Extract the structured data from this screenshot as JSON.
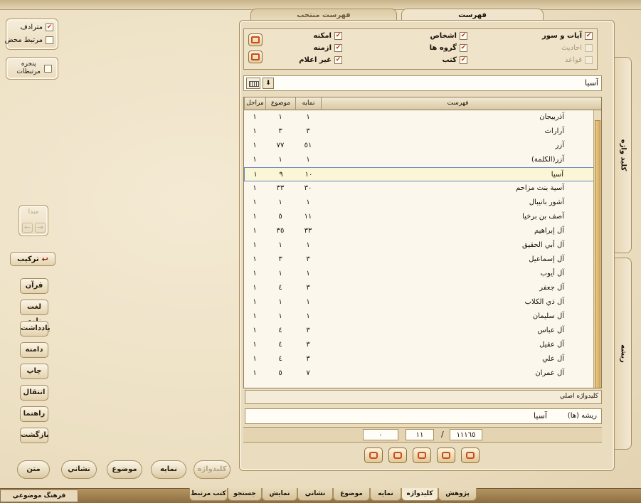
{
  "tabs_top": {
    "index": "فهرست",
    "selected_index": "فهرست منتخب"
  },
  "filters": {
    "col1": [
      {
        "label": "آيات و سور",
        "checked": true,
        "disabled": false
      },
      {
        "label": "احاديث",
        "checked": false,
        "disabled": true
      },
      {
        "label": "قواعد",
        "checked": false,
        "disabled": true
      }
    ],
    "col2": [
      {
        "label": "اشخاص",
        "checked": true,
        "disabled": false
      },
      {
        "label": "گروه ها",
        "checked": true,
        "disabled": false
      },
      {
        "label": "كتب",
        "checked": true,
        "disabled": false
      }
    ],
    "col3": [
      {
        "label": "امكنه",
        "checked": true,
        "disabled": false
      },
      {
        "label": "ازمنه",
        "checked": true,
        "disabled": false
      },
      {
        "label": "غير اعلام",
        "checked": true,
        "disabled": false
      }
    ]
  },
  "left_options": {
    "synonym": "مترادف",
    "pure_related": "مرتبط محض",
    "related_window_1": "پنجره",
    "related_window_2": "مرتبطات"
  },
  "search": {
    "value": "آسيا"
  },
  "table": {
    "headers": {
      "index": "فهرست",
      "occurrence": "نمايه",
      "topic": "موضوع",
      "level": "مراحل"
    },
    "rows": [
      {
        "name": "آذربيجان",
        "occurrence": "١",
        "topic": "١",
        "level": "١"
      },
      {
        "name": "آرارات",
        "occurrence": "٣",
        "topic": "٣",
        "level": "١"
      },
      {
        "name": "آزر",
        "occurrence": "٥١",
        "topic": "٧٧",
        "level": "١"
      },
      {
        "name": "آزر(الكلمة)",
        "occurrence": "١",
        "topic": "١",
        "level": "١"
      },
      {
        "name": "آسيا",
        "occurrence": "١٠",
        "topic": "٩",
        "level": "١"
      },
      {
        "name": "آسية بنت مزاحم",
        "occurrence": "٣٠",
        "topic": "٣٣",
        "level": "١"
      },
      {
        "name": "آشور بانيبال",
        "occurrence": "١",
        "topic": "١",
        "level": "١"
      },
      {
        "name": "آصف بن برخيا",
        "occurrence": "١١",
        "topic": "٥",
        "level": "١"
      },
      {
        "name": "آل إبراهيم",
        "occurrence": "٣٣",
        "topic": "٣٥",
        "level": "١"
      },
      {
        "name": "آل أبي الحقيق",
        "occurrence": "١",
        "topic": "١",
        "level": "١"
      },
      {
        "name": "آل إسماعيل",
        "occurrence": "٣",
        "topic": "٣",
        "level": "١"
      },
      {
        "name": "آل أيوب",
        "occurrence": "١",
        "topic": "١",
        "level": "١"
      },
      {
        "name": "آل جعفر",
        "occurrence": "٣",
        "topic": "٤",
        "level": "١"
      },
      {
        "name": "آل ذي الكلاب",
        "occurrence": "١",
        "topic": "١",
        "level": "١"
      },
      {
        "name": "آل سليمان",
        "occurrence": "١",
        "topic": "١",
        "level": "١"
      },
      {
        "name": "آل عباس",
        "occurrence": "٣",
        "topic": "٤",
        "level": "١"
      },
      {
        "name": "آل عقيل",
        "occurrence": "٣",
        "topic": "٤",
        "level": "١"
      },
      {
        "name": "آل علي",
        "occurrence": "٣",
        "topic": "٤",
        "level": "١"
      },
      {
        "name": "آل عمران",
        "occurrence": "٧",
        "topic": "٥",
        "level": "١"
      }
    ],
    "selected_index": 4
  },
  "root_keyword_label": "كليدواژه اصلي",
  "roots_label": "ريشه (ها)",
  "roots_value": "آسيا",
  "counter": {
    "total": "١١١٦٥",
    "separator": "/",
    "current": "١١",
    "zero": "٠"
  },
  "side_tabs": {
    "keyword": "كليد واژه",
    "root": "ريشه"
  },
  "left_nav": {
    "source": "مبدا",
    "compose": "تركيب",
    "quran": "قرآن",
    "dictionary": "لغت نامه",
    "notes": "يادداشت",
    "scope": "دامنه",
    "print": "چاپ",
    "transfer": "انتقال",
    "guide": "راهنما",
    "back": "بازگشت"
  },
  "bottom_pills": [
    "كليدواژه",
    "نمايه",
    "موضوع",
    "نشاني",
    "متن"
  ],
  "bottom_tabs": [
    "پژوهش",
    "كليدواژه",
    "نمايه",
    "موضوع",
    "نشاني",
    "نمايش",
    "جستجو",
    "كتب مرتبط"
  ],
  "app_title": "فرهنگ موضوعي تفسيرا"
}
